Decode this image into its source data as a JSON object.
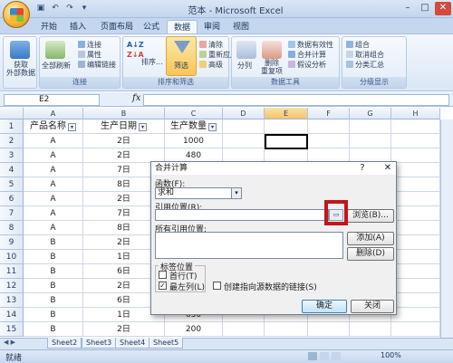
{
  "window": {
    "title": "范本 - Microsoft Excel",
    "controls": {
      "minimize": "–",
      "restore": "□",
      "close": "✕"
    }
  },
  "ribbon": {
    "tabs": [
      "开始",
      "插入",
      "页面布局",
      "公式",
      "数据",
      "审阅",
      "视图"
    ],
    "active_tab": "数据",
    "groups": {
      "external": {
        "label": "获取\n外部数据",
        "button": "获取外部数据"
      },
      "connections": {
        "label": "连接",
        "refresh": "全部刷新",
        "items": [
          "连接",
          "属性",
          "编辑链接"
        ]
      },
      "sort_filter": {
        "label": "排序和筛选",
        "sort": "排序...",
        "filter": "筛选",
        "items": [
          "清除",
          "重新应用",
          "高级"
        ]
      },
      "data_tools": {
        "label": "数据工具",
        "split": "分列",
        "remove_dup": "删除\n重复项",
        "items": [
          "数据有效性",
          "合并计算",
          "假设分析"
        ]
      },
      "outline": {
        "label": "分级显示",
        "items": [
          "组合",
          "取消组合",
          "分类汇总"
        ]
      }
    }
  },
  "formula_bar": {
    "name_box": "E2",
    "fx": "fx",
    "value": ""
  },
  "grid": {
    "columns": [
      "A",
      "B",
      "C",
      "D",
      "E",
      "F",
      "G",
      "H"
    ],
    "selected_column": "E",
    "headers": [
      "产品名称",
      "生产日期",
      "生产数量"
    ],
    "rows": [
      {
        "n": "1"
      },
      {
        "n": "2",
        "a": "A",
        "b": "2日",
        "c": "1000"
      },
      {
        "n": "3",
        "a": "A",
        "b": "2日",
        "c": "480"
      },
      {
        "n": "4",
        "a": "A",
        "b": "7日",
        "c": ""
      },
      {
        "n": "5",
        "a": "A",
        "b": "8日",
        "c": ""
      },
      {
        "n": "6",
        "a": "A",
        "b": "2日",
        "c": ""
      },
      {
        "n": "7",
        "a": "A",
        "b": "7日",
        "c": ""
      },
      {
        "n": "8",
        "a": "A",
        "b": "8日",
        "c": ""
      },
      {
        "n": "9",
        "a": "B",
        "b": "2日",
        "c": ""
      },
      {
        "n": "10",
        "a": "B",
        "b": "1日",
        "c": ""
      },
      {
        "n": "11",
        "a": "B",
        "b": "6日",
        "c": ""
      },
      {
        "n": "12",
        "a": "B",
        "b": "2日",
        "c": ""
      },
      {
        "n": "13",
        "a": "B",
        "b": "6日",
        "c": ""
      },
      {
        "n": "14",
        "a": "B",
        "b": "1日",
        "c": "630"
      },
      {
        "n": "15",
        "a": "B",
        "b": "2日",
        "c": "200"
      }
    ]
  },
  "sheets": {
    "tabs": [
      "Sheet2",
      "Sheet3",
      "Sheet4",
      "Sheet5"
    ]
  },
  "status": {
    "text": "就绪",
    "zoom": "100%"
  },
  "dialog": {
    "title": "合并计算",
    "help": "?",
    "close": "✕",
    "function_label": "函数(F):",
    "function_value": "求和",
    "reference_label": "引用位置(R):",
    "reference_value": "",
    "browse": "浏览(B)...",
    "all_refs_label": "所有引用位置:",
    "add": "添加(A)",
    "delete": "删除(D)",
    "label_group": "标签位置",
    "first_row": "首行(T)",
    "left_column": "最左列(L)",
    "left_column_checked": true,
    "first_row_checked": false,
    "link_source": "创建指向源数据的链接(S)",
    "link_source_checked": false,
    "ok": "确定",
    "close_btn": "关闭"
  },
  "colors": {
    "highlight": "#c0171b",
    "active_tab": "#f4f8fd",
    "selection": "#000000"
  }
}
